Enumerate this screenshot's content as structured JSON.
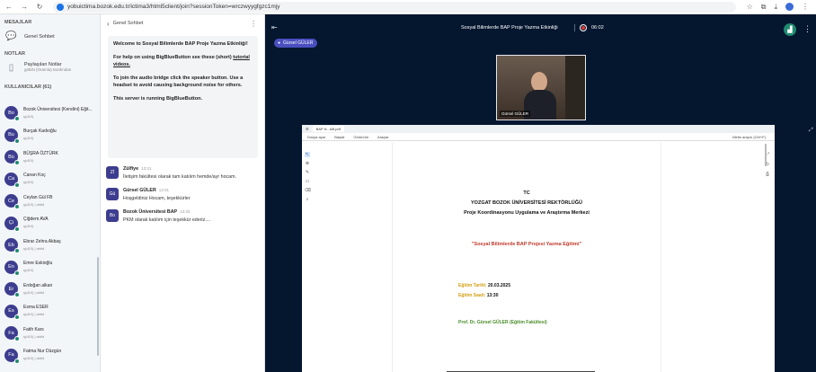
{
  "browser": {
    "url": "yobuictima.bozok.edu.tr/ictima3/html5client/join?sessionToken=wrczwyygfgzc1mjy"
  },
  "sidebar": {
    "messages_title": "MESAJLAR",
    "public_chat": "Genel Sohbet",
    "notes_title": "NOTLAR",
    "shared_notes": "Paylaşılan Notlar",
    "shared_notes_sub": "gölüN (Oramla) tarafından",
    "users_title": "KULLANICILAR (61)",
    "users": [
      {
        "initials": "Bo",
        "name": "Bozok Üniversitesi (Kendini) Eğit...",
        "role": "ş(d10)"
      },
      {
        "initials": "Bu",
        "name": "Burçak Kadıoğlu",
        "role": "ş(d10)"
      },
      {
        "initials": "Bü",
        "name": "BÜŞRA ÖZTÜRK",
        "role": "ş(d10)"
      },
      {
        "initials": "Ca",
        "name": "Canan Koç",
        "role": "ş(d10)"
      },
      {
        "initials": "Ce",
        "name": "Ceylan Gül FB",
        "role": "ş(d10) | ahtid"
      },
      {
        "initials": "Çi",
        "name": "Çiğdem AVA",
        "role": "ş(d10)"
      },
      {
        "initials": "Eb",
        "name": "Ebrar Zehra Akbaş",
        "role": "ş(d10) | ahtid"
      },
      {
        "initials": "En",
        "name": "Emre Eskioğlu",
        "role": "ş(d10)"
      },
      {
        "initials": "Er",
        "name": "Erdoğan alkan",
        "role": "ş(d10) | ahtid"
      },
      {
        "initials": "Es",
        "name": "Esma ESER",
        "role": "ş(d10) | ahtid"
      },
      {
        "initials": "Fa",
        "name": "Fatih Kars",
        "role": "ş(d10) | ahtid"
      },
      {
        "initials": "Fa",
        "name": "Fatma Nur Düzgün",
        "role": "ş(d10) | ahtid"
      }
    ]
  },
  "chat": {
    "back_label": "Genel Sohbet",
    "welcome_title": "Welcome to Sosyal Bilimlerde BAP Proje Yazma Etkinliği!",
    "welcome_help": "For help on using BigBlueButton see these (short)",
    "welcome_link": "tutorial videos.",
    "welcome_audio": "To join the audio bridge click the speaker button. Use a headset to avoid causing background noise for others.",
    "welcome_server": "This server is running BigBlueButton.",
    "messages": [
      {
        "initials": "Zİ",
        "author": "Zülfiye",
        "time": "13:31",
        "text": "İletişim fakültesi olarak tam katılım hemde/ayr hocam."
      },
      {
        "initials": "Gü",
        "author": "Gürsel GÜLER",
        "time": "13:31",
        "text": "Hoşgeldiniz Hocam, teşekkürler"
      },
      {
        "initials": "Bo",
        "author": "Bozok Üniversitesi BAP",
        "time": "13:32",
        "text": "PKM olarak katılım için teşekkür ederiz...."
      }
    ]
  },
  "main": {
    "meeting_title": "Sosyal Bilimlerde BAP Proje Yazma Etkinliği",
    "timer": "06:02",
    "presenter_name": "Gürsel GÜLER",
    "webcam_label": "Gürsel GÜLER"
  },
  "presentation": {
    "tab_label": "BAP N...AB.pdf",
    "menu_file": "Dosya ayar",
    "menu_home": "Başlat",
    "menu_view": "Görünüm",
    "menu_tools": "Araçlar",
    "menu_right": "Metin arayın (Ctrl+F)",
    "doc_line1": "TC",
    "doc_line2": "YOZGAT BOZOK ÜNİVERSİTESİ REKTÖRLÜĞÜ",
    "doc_line3": "Proje Koordinasyonu Uygulama ve Araştırma Merkezi",
    "doc_title": "\"Sosyal Bilimlerde BAP Projesi Yazma Eğitimi\"",
    "date_label": "Eğitim Tarihi:",
    "date_value": "20.03.2025",
    "time_label": "Eğitim Saati:",
    "time_value": "13:30",
    "speaker_line": "Prof. Dr. Gürsel GÜLER (Eğitim Fakültesi)"
  }
}
